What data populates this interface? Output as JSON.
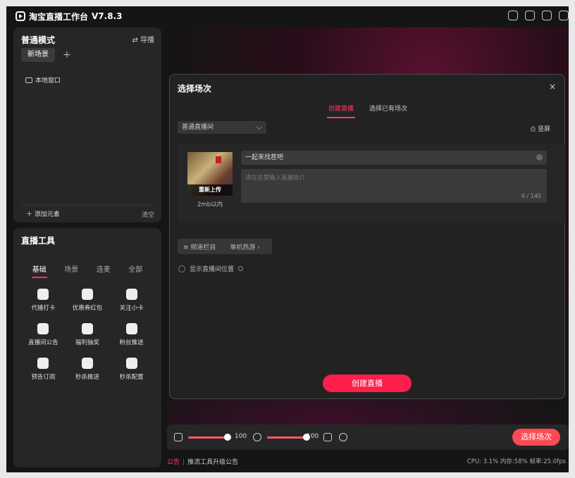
{
  "app": {
    "title": "淘宝直播工作台",
    "version": "V7.8.3"
  },
  "scene_panel": {
    "title": "普通模式",
    "guide": "导播",
    "new_scene": "新场景",
    "source_local": "本地窗口",
    "add_element": "添加元素",
    "clear": "清空"
  },
  "tools_panel": {
    "title": "直播工具",
    "tabs": [
      "基础",
      "场景",
      "连麦",
      "全部"
    ],
    "items": [
      "代播打卡",
      "优惠券红包",
      "关注小卡",
      "直播间公告",
      "福利抽奖",
      "粉丝推送",
      "预告订阅",
      "秒杀推送",
      "秒杀配置"
    ]
  },
  "modal": {
    "title": "选择场次",
    "close": "×",
    "tabs": [
      "创建直播",
      "选择已有场次"
    ],
    "room_type": "普通直播间",
    "orientation": "竖屏",
    "cover_reupload": "重新上传",
    "cover_size_hint": "2mb以内",
    "title_value": "一起来找茬吧",
    "intro_placeholder": "请在这里输入直播简介",
    "intro_count": "0 / 140",
    "channel_label": "频道栏目",
    "channel_value": "单机热游",
    "show_position": "显示直播间位置",
    "create_button": "创建直播"
  },
  "bottombar": {
    "speaker_volume": "100",
    "mic_volume": "100",
    "speaker_level": 1.0,
    "mic_level": 1.0,
    "select_session_button": "选择场次"
  },
  "footer": {
    "notice_label": "公告",
    "notice_text": "推流工具升级公告",
    "status": "CPU: 3.1% 内存:58% 帧率:25.0fps"
  }
}
